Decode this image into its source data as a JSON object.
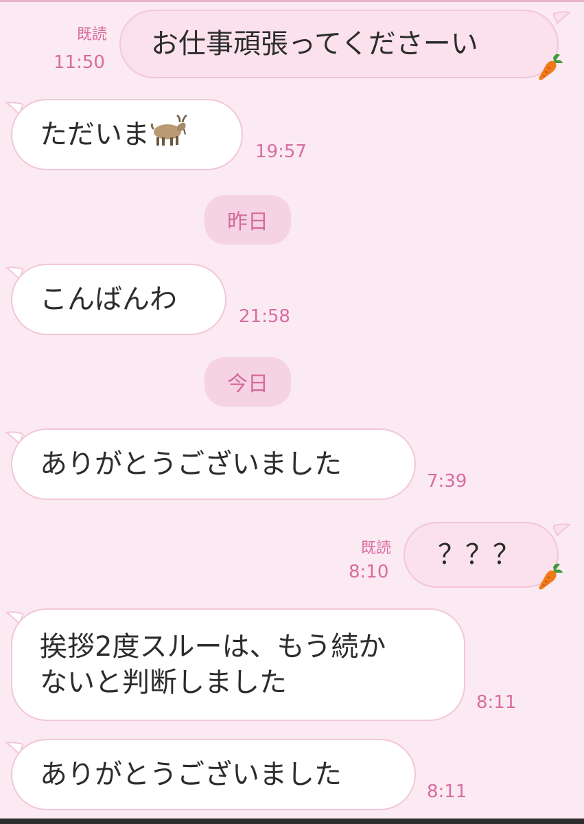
{
  "theme": {
    "background": "#fbeaf1",
    "accent": "#d96ca0",
    "bubble_out": "#fbe1ec",
    "bubble_in": "#ffffff",
    "bubble_border": "#f2c6d8"
  },
  "messages": [
    {
      "id": "m1",
      "direction": "out",
      "text": "お仕事頑張ってくださーい",
      "read_label": "既読",
      "time": "11:50",
      "sticker_icon": "carrot-icon"
    },
    {
      "id": "m2",
      "direction": "in",
      "text": "ただいま",
      "time": "19:57",
      "emoji_icon": "goat-icon"
    },
    {
      "id": "m3",
      "direction": "in",
      "text": "こんばんわ",
      "time": "21:58"
    },
    {
      "id": "m4",
      "direction": "in",
      "text": "ありがとうございました",
      "time": "7:39"
    },
    {
      "id": "m5",
      "direction": "out",
      "text": "？？？",
      "read_label": "既読",
      "time": "8:10",
      "sticker_icon": "carrot-icon"
    },
    {
      "id": "m6",
      "direction": "in",
      "line1": "挨拶2度スルーは、もう続か",
      "line2": "ないと判断しました",
      "time": "8:11"
    },
    {
      "id": "m7",
      "direction": "in",
      "text": "ありがとうございました",
      "time": "8:11"
    }
  ],
  "date_separators": {
    "yesterday": "昨日",
    "today": "今日"
  }
}
